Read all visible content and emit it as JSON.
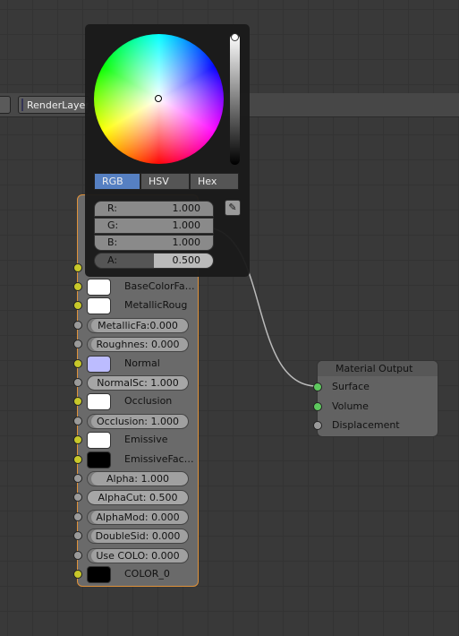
{
  "header": {
    "render_layer": "RenderLayer"
  },
  "color_picker": {
    "modes": [
      "RGB",
      "HSV",
      "Hex"
    ],
    "active_mode": "RGB",
    "fields": [
      {
        "label": "R:",
        "value": "1.000"
      },
      {
        "label": "G:",
        "value": "1.000"
      },
      {
        "label": "B:",
        "value": "1.000"
      },
      {
        "label": "A:",
        "value": "0.500"
      }
    ],
    "alpha_fraction": 0.5,
    "value_level": 1.0
  },
  "node": {
    "rows": [
      {
        "type": "color",
        "label": "BaseColorFa…",
        "socket": "yellow",
        "swatch": "#ffffff"
      },
      {
        "type": "color",
        "label": "MetallicRoug",
        "socket": "yellow",
        "swatch": "#ffffff"
      },
      {
        "type": "field",
        "label": "MetallicFa:0.000",
        "socket": "gray"
      },
      {
        "type": "field",
        "label": "Roughnes: 0.000",
        "socket": "gray"
      },
      {
        "type": "color",
        "label": "Normal",
        "socket": "yellow",
        "swatch": "#bcbcff"
      },
      {
        "type": "field",
        "label": "NormalSc: 1.000",
        "socket": "gray",
        "arrows": true
      },
      {
        "type": "color",
        "label": "Occlusion",
        "socket": "yellow",
        "swatch": "#ffffff"
      },
      {
        "type": "field",
        "label": "Occlusion: 1.000",
        "socket": "gray"
      },
      {
        "type": "color",
        "label": "Emissive",
        "socket": "yellow",
        "swatch": "#ffffff"
      },
      {
        "type": "color",
        "label": "EmissiveFac…",
        "socket": "yellow",
        "swatch": "#000000"
      },
      {
        "type": "field",
        "label": "Alpha:        1.000",
        "socket": "gray"
      },
      {
        "type": "field",
        "label": "AlphaCut:  0.500",
        "socket": "gray",
        "arrows": true
      },
      {
        "type": "field",
        "label": "AlphaMod: 0.000",
        "socket": "gray"
      },
      {
        "type": "field",
        "label": "DoubleSid: 0.000",
        "socket": "gray"
      },
      {
        "type": "field",
        "label": "Use COLO: 0.000",
        "socket": "gray"
      },
      {
        "type": "color",
        "label": "COLOR_0",
        "socket": "yellow",
        "swatch": "#000000"
      }
    ]
  },
  "material_output": {
    "title": "Material Output",
    "inputs": [
      {
        "label": "Surface",
        "socket": "green"
      },
      {
        "label": "Volume",
        "socket": "green"
      },
      {
        "label": "Displacement",
        "socket": "gray"
      }
    ]
  }
}
